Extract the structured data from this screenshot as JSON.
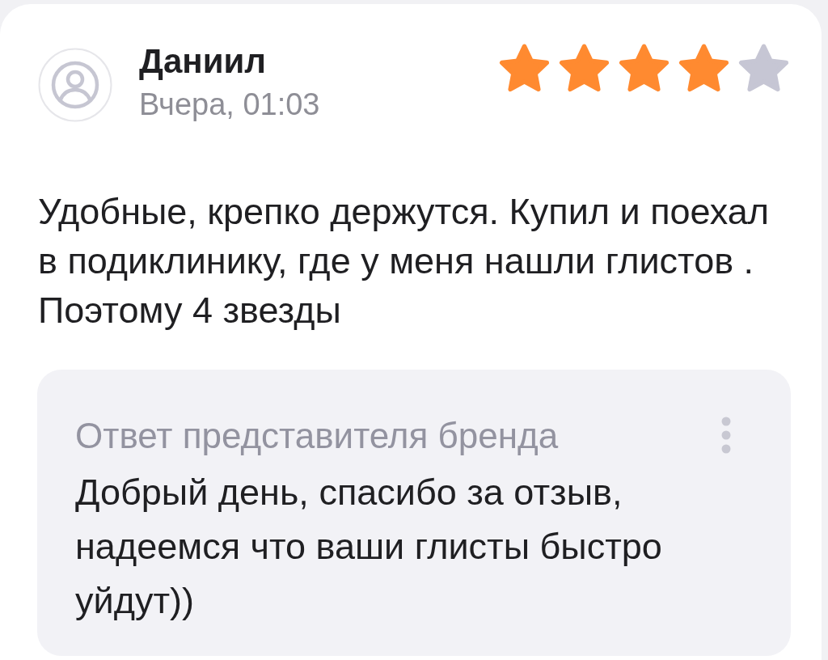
{
  "review": {
    "author": "Даниил",
    "date": "Вчера, 01:03",
    "stars": 4,
    "text": "Удобные, крепко держутся. Купил и поехал в подиклинику, где у меня нашли глистов . Поэтому 4 звезды"
  },
  "brand_reply": {
    "title": "Ответ представителя бренда",
    "text": "Добрый день, спасибо за отзыв, надеемся что ваши глисты быстро уйдут))"
  }
}
